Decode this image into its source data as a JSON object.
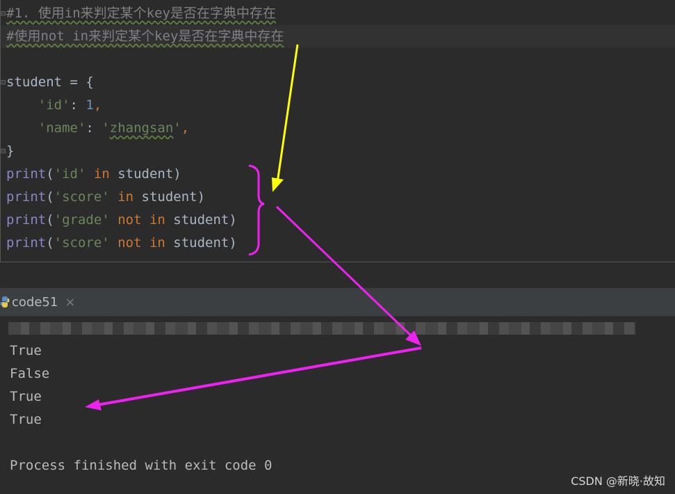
{
  "editor": {
    "comment1": "#1. 使用in来判定某个key是否在字典中存在",
    "comment2": "#使用not in来判定某个key是否在字典中存在",
    "dict_open_name": "student",
    "dict_open_rest": " = {",
    "key_id": "'id'",
    "val_id": "1",
    "key_name": "'name'",
    "val_name_q1": "'",
    "val_name": "zhangsan",
    "val_name_q2": "'",
    "close_brace": "}",
    "print_fn": "print",
    "prints": [
      {
        "str": "'id'",
        "op": "in",
        "var": "student"
      },
      {
        "str": "'score'",
        "op": "in",
        "var": "student"
      },
      {
        "str": "'grade'",
        "op": "not in",
        "var": "student"
      },
      {
        "str": "'score'",
        "op": "not in",
        "var": "student"
      }
    ]
  },
  "run_tab": {
    "label": "code51",
    "close": "×"
  },
  "console": {
    "outputs": [
      "True",
      "False",
      "True",
      "True"
    ],
    "exit_message": "Process finished with exit code 0"
  },
  "watermark": "CSDN @新晓·故知",
  "colors": {
    "annotation_yellow": "#ffff00",
    "annotation_magenta": "#ee22ee"
  }
}
